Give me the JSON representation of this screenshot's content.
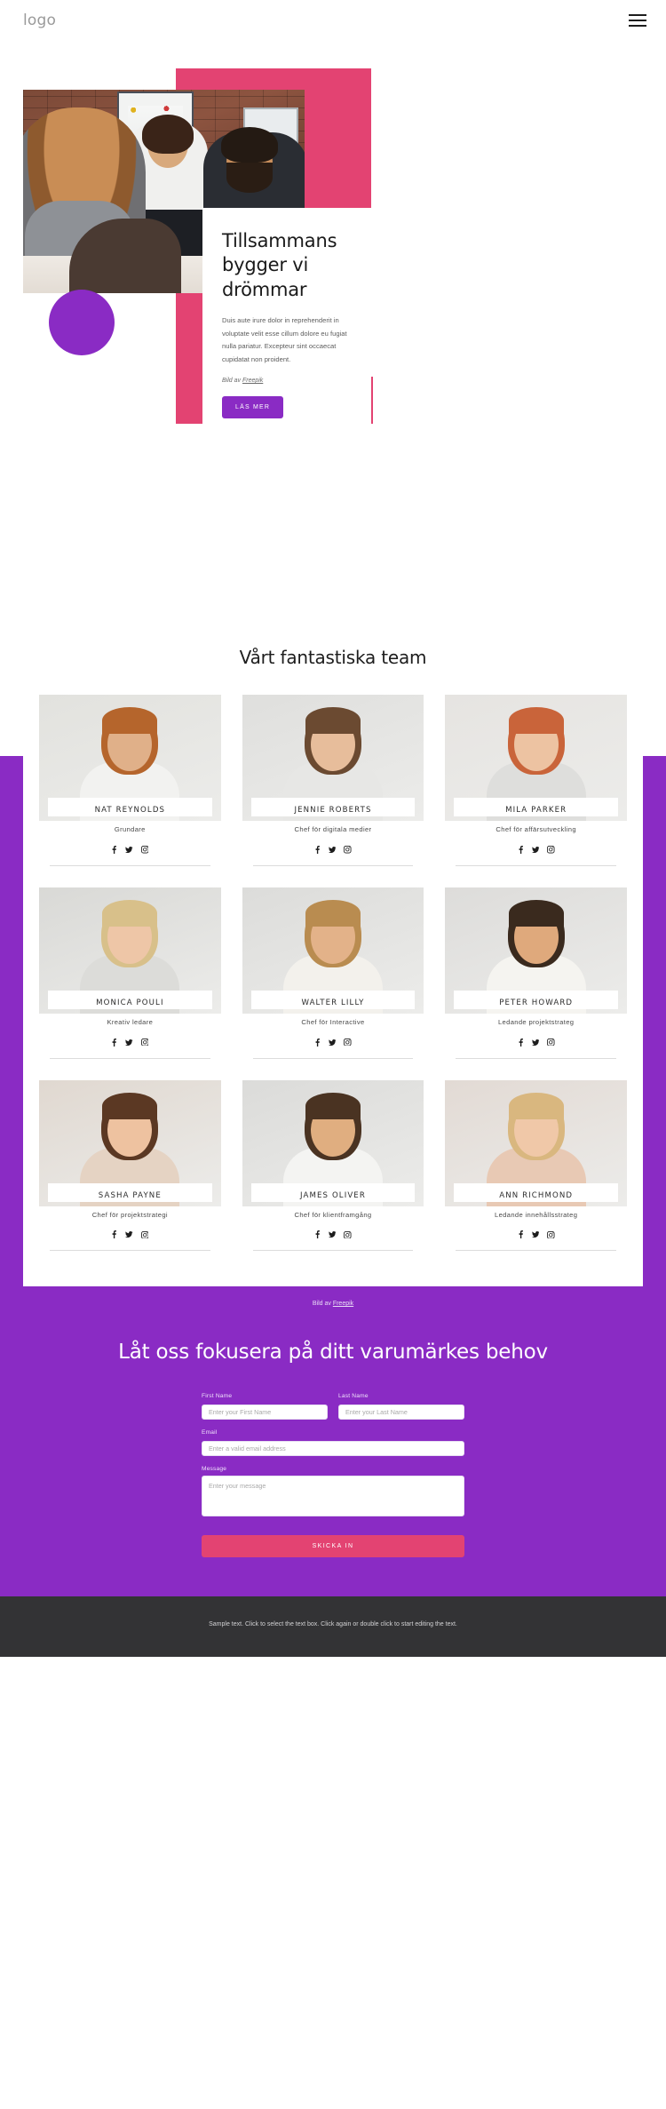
{
  "header": {
    "logo": "logo",
    "menu_label": "menu"
  },
  "hero": {
    "title": "Tillsammans bygger vi drömmar",
    "paragraph": "Duis aute irure dolor in reprehenderit in voluptate velit esse cillum dolore eu fugiat nulla pariatur. Excepteur sint occaecat cupidatat non proident.",
    "credit_prefix": "Bild av ",
    "credit_link": "Freepik",
    "cta_label": "LÄS MER"
  },
  "team": {
    "title": "Vårt fantastiska team",
    "credit_prefix": "Bild av ",
    "credit_link": "Freepik",
    "social": {
      "facebook": "facebook-icon",
      "twitter": "twitter-icon",
      "instagram": "instagram-icon"
    },
    "members": [
      {
        "name": "NAT REYNOLDS",
        "role": "Grundare",
        "skin": "#e0b089",
        "hair": "#b5652c",
        "shirt": "#f2f2f0",
        "bg": "#e2e2de"
      },
      {
        "name": "JENNIE ROBERTS",
        "role": "Chef för digitala medier",
        "skin": "#e7bd9b",
        "hair": "#6b4a31",
        "shirt": "#e7e7e5",
        "bg": "#dfdfdd"
      },
      {
        "name": "MILA PARKER",
        "role": "Chef för affärsutveckling",
        "skin": "#edc3a2",
        "hair": "#c9643a",
        "shirt": "#dededc",
        "bg": "#e6e4e1"
      },
      {
        "name": "MONICA POULI",
        "role": "Kreativ ledare",
        "skin": "#eec6a7",
        "hair": "#d8c08a",
        "shirt": "#dcdcd9",
        "bg": "#d9d9d6"
      },
      {
        "name": "WALTER LILLY",
        "role": "Chef för Interactive",
        "skin": "#e3b289",
        "hair": "#b98c50",
        "shirt": "#f3f1ec",
        "bg": "#dcdcda"
      },
      {
        "name": "PETER HOWARD",
        "role": "Ledande projektstrateg",
        "skin": "#dfa97c",
        "hair": "#3a2a1e",
        "shirt": "#f5f4f0",
        "bg": "#dddcda"
      },
      {
        "name": "SASHA PAYNE",
        "role": "Chef för projektstrategi",
        "skin": "#eec2a0",
        "hair": "#5b3823",
        "shirt": "#e5d3c3",
        "bg": "#e0d8d0"
      },
      {
        "name": "JAMES OLIVER",
        "role": "Chef för klientframgång",
        "skin": "#e0ae80",
        "hair": "#4a3322",
        "shirt": "#f4f4f2",
        "bg": "#dbdbd9"
      },
      {
        "name": "ANN RICHMOND",
        "role": "Ledande innehållsstrateg",
        "skin": "#f0c8a8",
        "hair": "#d9b77f",
        "shirt": "#e8c9b4",
        "bg": "#e2dad4"
      }
    ]
  },
  "cta": {
    "title": "Låt oss fokusera på ditt varumärkes behov",
    "fields": {
      "first_name_label": "First Name",
      "first_name_placeholder": "Enter your First Name",
      "last_name_label": "Last Name",
      "last_name_placeholder": "Enter your Last Name",
      "email_label": "Email",
      "email_placeholder": "Enter a valid email address",
      "message_label": "Message",
      "message_placeholder": "Enter your message"
    },
    "submit_label": "SKICKA IN"
  },
  "footer": {
    "text": "Sample text. Click to select the text box. Click again or double click to start editing the text."
  },
  "colors": {
    "purple": "#8a2bc4",
    "pink": "#e34372",
    "footer_bg": "#333335"
  }
}
